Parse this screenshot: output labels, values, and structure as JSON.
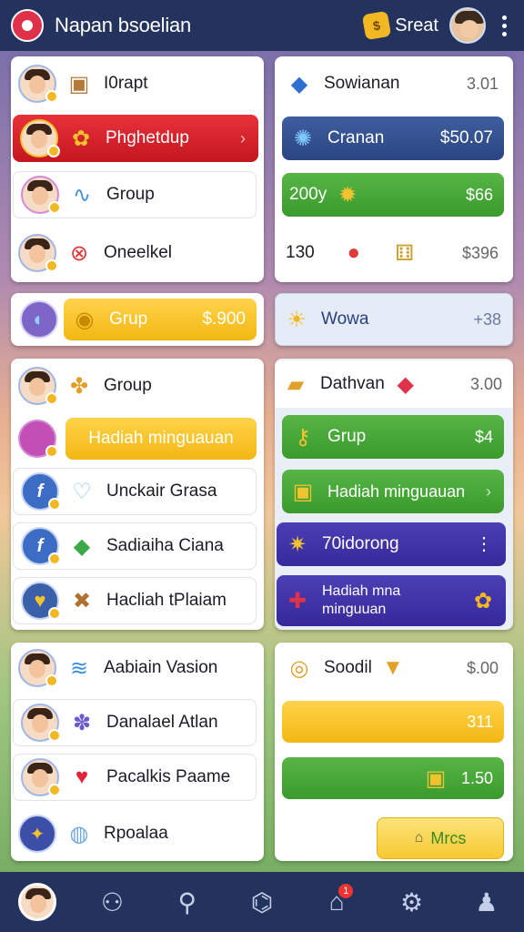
{
  "header": {
    "title": "Napan bsoelian",
    "streak_label": "Sreat",
    "app_logo_icon": "app-logo-icon",
    "streak_icon": "coin-icon",
    "more_icon": "kebab-icon"
  },
  "left_panel_1": {
    "rows": [
      {
        "label": "I0rapt",
        "icon": "box-icon"
      },
      {
        "label": "Phghetdup",
        "icon": "gift-icon",
        "style": "red"
      },
      {
        "label": "Group",
        "icon": "bird-icon"
      },
      {
        "label": "Oneelkel",
        "icon": "close-circle-icon"
      }
    ]
  },
  "right_panel_1": {
    "rows": [
      {
        "label": "Sowianan",
        "value": "3.01",
        "icon": "cube-icon"
      },
      {
        "label": "Cranan",
        "value": "$50.07",
        "icon": "fish-icon",
        "style": "navy"
      },
      {
        "label": "200y",
        "value": "$66",
        "icon": "gear-gold-icon",
        "style": "green"
      },
      {
        "label": "130",
        "value": "$396",
        "icon": "apple-icon"
      }
    ]
  },
  "left_panel_2": {
    "label": "Grup",
    "value": "$.900",
    "icon": "shield-icon"
  },
  "right_panel_2": {
    "label": "Wowa",
    "value": "+38",
    "icon": "sun-icon"
  },
  "left_panel_3": {
    "rows": [
      {
        "label": "Group",
        "icon": "puzzle-icon"
      },
      {
        "label": "Hadiah minguauan",
        "icon": "ring-icon",
        "style": "yellow"
      },
      {
        "label": "Unckair Grasa",
        "icon": "heart-icon"
      },
      {
        "label": "Sadiaiha Ciana",
        "icon": "gem-icon"
      },
      {
        "label": "Hacliah tPlaiam",
        "icon": "cross-icon"
      }
    ]
  },
  "right_panel_3": {
    "rows": [
      {
        "label": "Dathvan",
        "value": "3.00",
        "icon": "gold-box-icon"
      },
      {
        "label": "Grup",
        "value": "$4",
        "icon": "key-icon",
        "style": "green"
      },
      {
        "label": "Hadiah minguauan",
        "icon": "chest-icon",
        "style": "green"
      },
      {
        "label": "70idorong",
        "icon": "star-cluster-icon",
        "style": "purple"
      },
      {
        "label": "Hadiah mna minguuan",
        "icon": "present-icon",
        "style": "purple"
      }
    ]
  },
  "left_panel_4": {
    "rows": [
      {
        "label": "Aabiain Vasion",
        "icon": "wave-icon"
      },
      {
        "label": "Danalael Atlan",
        "icon": "grapes-icon"
      },
      {
        "label": "Pacalkis Paame",
        "icon": "heart-icon"
      },
      {
        "label": "Rpoalaa",
        "icon": "bubble-icon"
      }
    ]
  },
  "right_panel_4": {
    "rows": [
      {
        "label": "Soodil",
        "value": "$.00",
        "icon": "medal-icon"
      },
      {
        "label": "",
        "value": "311",
        "style": "yellow"
      },
      {
        "label": "",
        "value": "1.50",
        "icon": "chest-icon",
        "style": "green"
      }
    ],
    "button_label": "Mrcs"
  },
  "bottom_nav": {
    "items": [
      "profile-avatar",
      "friends-icon",
      "search-icon",
      "tag-icon",
      "home-icon",
      "settings-icon",
      "user-icon"
    ],
    "home_badge": "1"
  }
}
